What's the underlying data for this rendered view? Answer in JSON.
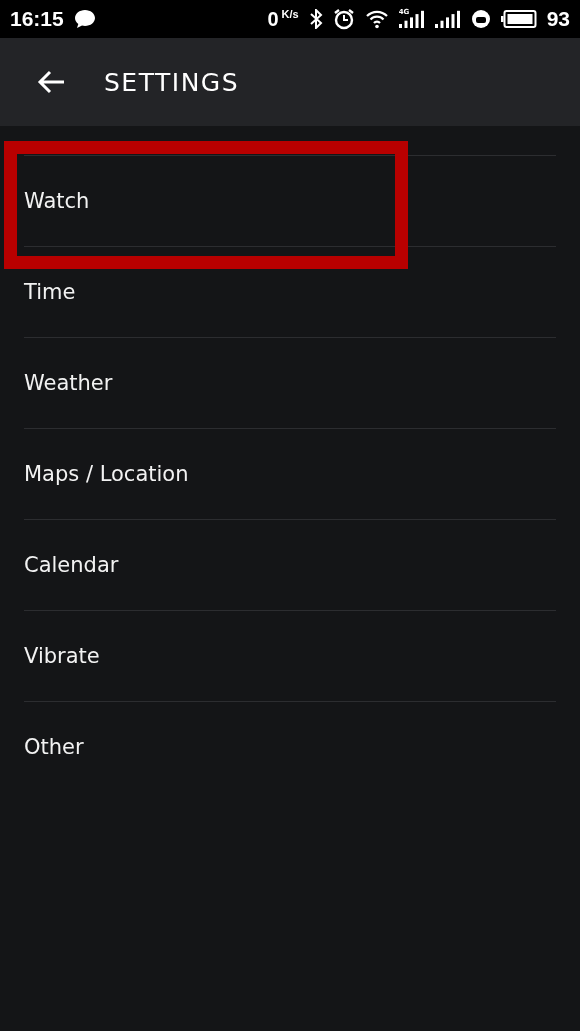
{
  "status_bar": {
    "time": "16:15",
    "speed_value": "0",
    "speed_unit": "K/s",
    "network": "4G",
    "battery": "93"
  },
  "header": {
    "title": "SETTINGS"
  },
  "items": [
    {
      "label": "Watch",
      "highlighted": true
    },
    {
      "label": "Time",
      "highlighted": false
    },
    {
      "label": "Weather",
      "highlighted": false
    },
    {
      "label": "Maps / Location",
      "highlighted": false
    },
    {
      "label": "Calendar",
      "highlighted": false
    },
    {
      "label": "Vibrate",
      "highlighted": false
    },
    {
      "label": "Other",
      "highlighted": false
    }
  ]
}
